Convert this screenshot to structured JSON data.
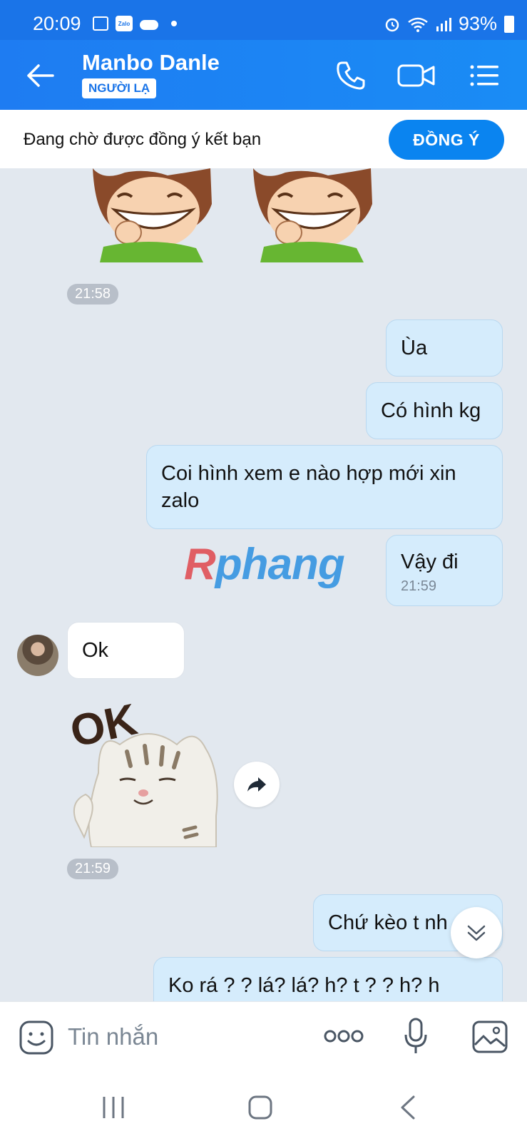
{
  "status_bar": {
    "time": "20:09",
    "zalo_label": "Zalo",
    "battery": "93%"
  },
  "header": {
    "contact_name": "Manbo Danle",
    "badge": "NGƯỜI LẠ",
    "icons": [
      "back-arrow-icon",
      "phone-icon",
      "video-call-icon",
      "menu-icon"
    ]
  },
  "banner": {
    "text": "Đang chờ được đồng ý kết bạn",
    "accept_label": "ĐỒNG Ý"
  },
  "chat": {
    "timestamp_1": "21:58",
    "timestamp_2": "21:59",
    "watermark": {
      "first": "R",
      "rest": "phang"
    },
    "messages": [
      {
        "direction": "out",
        "text": "Ùa"
      },
      {
        "direction": "out",
        "text": "Có hình kg"
      },
      {
        "direction": "out",
        "text": "Coi hình xem e nào hợp mới xin zalo"
      },
      {
        "direction": "out",
        "text": "Vậy đi",
        "time": "21:59"
      },
      {
        "direction": "in",
        "text": "Ok"
      },
      {
        "direction": "out",
        "text": "Chứ kèo t nh"
      },
      {
        "direction": "out",
        "text": "Ko rá ? ? lá? lá? h? t ? ? h? h"
      }
    ],
    "sticker_ok_text": "OK"
  },
  "input": {
    "placeholder": "Tin nhắn"
  },
  "colors": {
    "brand_blue": "#1a74e8",
    "chat_bg": "#e2e8ef",
    "outgoing_bubble": "#d5ecfc",
    "incoming_bubble": "#ffffff"
  }
}
